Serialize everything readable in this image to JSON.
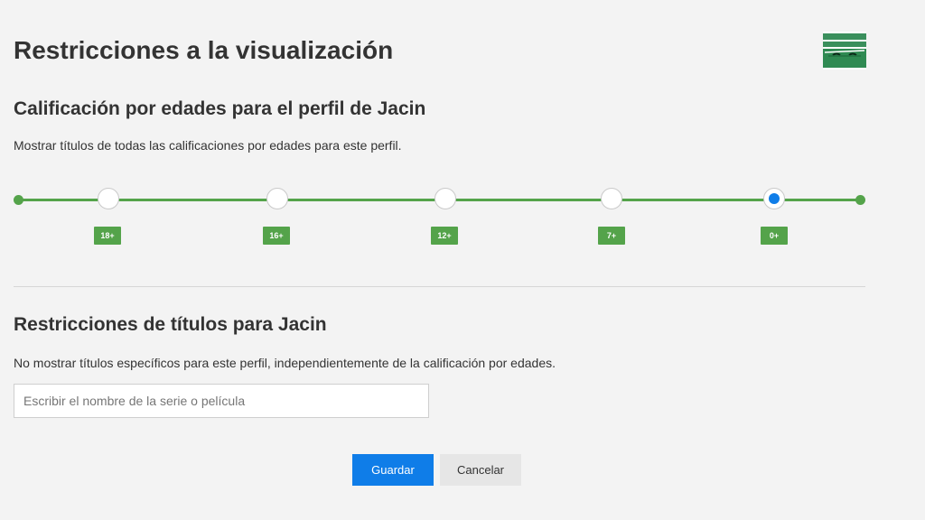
{
  "page": {
    "title": "Restricciones a la visualización"
  },
  "maturity": {
    "title": "Calificación por edades para el perfil de Jacin",
    "description": "Mostrar títulos de todas las calificaciones por edades para este perfil.",
    "levels": [
      "18+",
      "16+",
      "12+",
      "7+",
      "0+"
    ],
    "selected": "0+"
  },
  "title_restrictions": {
    "title": "Restricciones de títulos para Jacin",
    "description": "No mostrar títulos específicos para este perfil, independientemente de la calificación por edades.",
    "search_placeholder": "Escribir el nombre de la serie o película",
    "search_value": ""
  },
  "buttons": {
    "save_label": "Guardar",
    "cancel_label": "Cancelar"
  },
  "colors": {
    "accent_green": "#54a34a",
    "accent_blue": "#0f7de8",
    "background": "#f3f3f3"
  },
  "icons": {
    "avatar": "profile-avatar-icon"
  }
}
